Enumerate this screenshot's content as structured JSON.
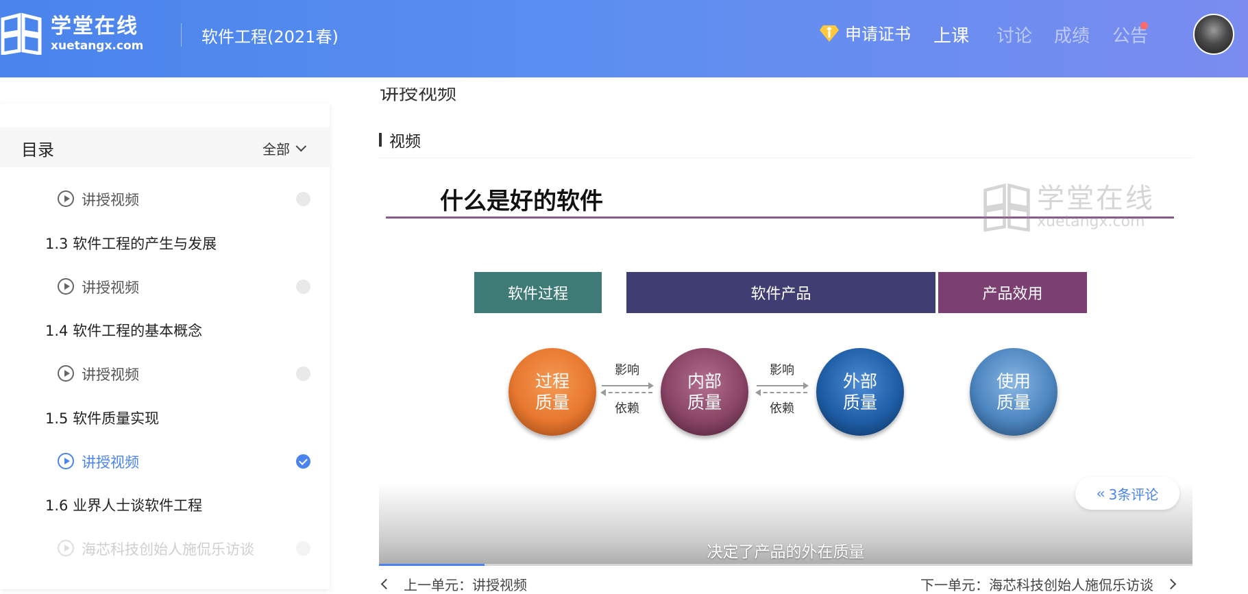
{
  "header": {
    "logo_cn": "学堂在线",
    "logo_en": "xuetangx.com",
    "course_title": "软件工程(2021春)",
    "cert_label": "申请证书",
    "nav": [
      "上课",
      "讨论",
      "成绩",
      "公告"
    ],
    "brand_color": "#4a84ec"
  },
  "sidebar": {
    "title": "目录",
    "filter": "全部",
    "items": [
      {
        "type": "video",
        "label": "讲授视频",
        "state": "normal"
      },
      {
        "type": "section",
        "label": "1.3 软件工程的产生与发展"
      },
      {
        "type": "video",
        "label": "讲授视频",
        "state": "normal"
      },
      {
        "type": "section",
        "label": "1.4 软件工程的基本概念"
      },
      {
        "type": "video",
        "label": "讲授视频",
        "state": "normal"
      },
      {
        "type": "section",
        "label": "1.5 软件质量实现"
      },
      {
        "type": "video",
        "label": "讲授视频",
        "state": "active"
      },
      {
        "type": "section",
        "label": "1.6 业界人士谈软件工程"
      },
      {
        "type": "video",
        "label": "海芯科技创始人施侃乐访谈",
        "state": "faded"
      }
    ]
  },
  "main": {
    "cut_title": "讲授视频",
    "section_heading": "视频",
    "slide": {
      "title": "什么是好的软件",
      "watermark_cn": "学堂在线",
      "watermark_en": "xuetangx.com",
      "boxes": [
        {
          "label": "软件过程",
          "color": "#3e7b76"
        },
        {
          "label": "软件产品",
          "color": "#403d73"
        },
        {
          "label": "产品效用",
          "color": "#7b3f72"
        }
      ],
      "circles": [
        {
          "line1": "过程",
          "line2": "质量",
          "color": "#e8782f"
        },
        {
          "line1": "内部",
          "line2": "质量",
          "color": "#8a4567"
        },
        {
          "line1": "外部",
          "line2": "质量",
          "color": "#1f5fa8"
        },
        {
          "line1": "使用",
          "line2": "质量",
          "color": "#4d86c0"
        }
      ],
      "arrow_top": "影响",
      "arrow_bottom": "依赖"
    },
    "subtitle": "决定了产品的外在质量",
    "comments": "3条评论",
    "progress": 0.13,
    "prev": "上一单元：讲授视频",
    "next": "下一单元：海芯科技创始人施侃乐访谈"
  }
}
